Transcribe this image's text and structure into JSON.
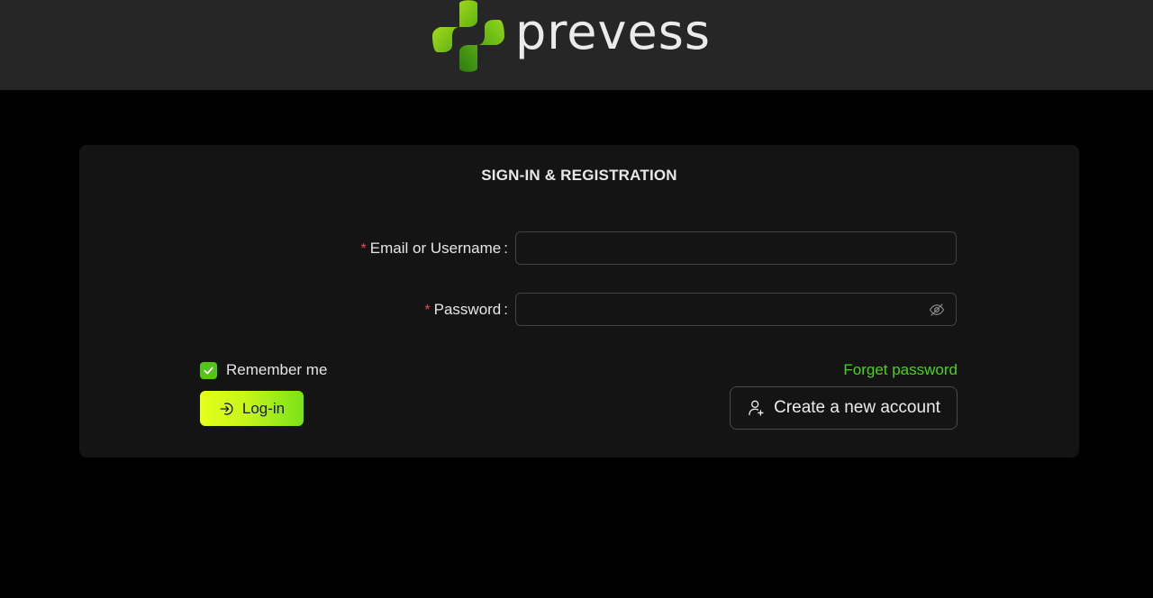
{
  "header": {
    "logo_text": "prevess",
    "brand_colors": {
      "logo_green_light": "#a8e61c",
      "logo_green_dark": "#2f8a12"
    }
  },
  "form": {
    "title": "SIGN-IN & REGISTRATION",
    "required_marker": "*",
    "username": {
      "label": "Email or Username",
      "value": "",
      "placeholder": ""
    },
    "password": {
      "label": "Password",
      "value": "",
      "placeholder": "",
      "visibility_icon": "eye-slash-icon"
    },
    "remember_me": {
      "label": "Remember me",
      "checked": true
    },
    "forgot_password_label": "Forget password",
    "login_button": {
      "label": "Log-in",
      "icon": "login-icon"
    },
    "create_account_button": {
      "label": "Create a new account",
      "icon": "user-add-icon"
    }
  },
  "colors": {
    "accent_green": "#49d31a",
    "checkbox_green": "#52c41a",
    "required_red": "#e5484d",
    "login_gradient_start": "#e6ff1a",
    "login_gradient_end": "#79e218",
    "header_bg": "#262626",
    "card_bg": "#141414",
    "page_bg": "#000000"
  }
}
